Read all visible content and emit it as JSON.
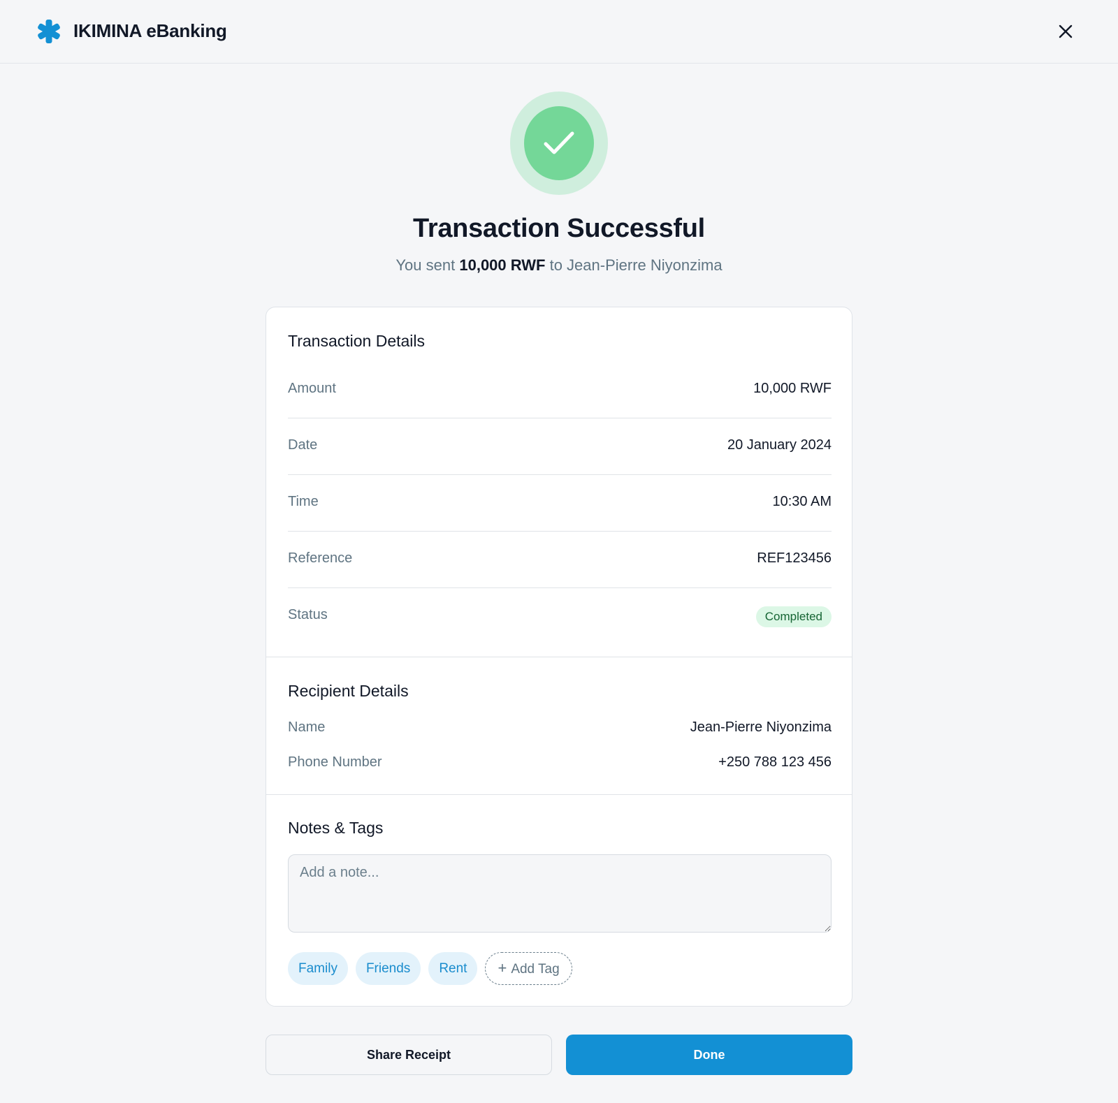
{
  "app": {
    "title": "IKIMINA eBanking",
    "logo_icon": "asterisk-logo-icon",
    "close_icon": "close-icon"
  },
  "hero": {
    "icon": "check-icon",
    "title": "Transaction Successful",
    "subtitle_prefix": "You sent",
    "subtitle_amount": "10,000 RWF",
    "subtitle_suffix": "to Jean-Pierre Niyonzima"
  },
  "transaction": {
    "title": "Transaction Details",
    "rows": [
      {
        "label": "Amount",
        "value": "10,000 RWF"
      },
      {
        "label": "Date",
        "value": "20 January 2024"
      },
      {
        "label": "Time",
        "value": "10:30 AM"
      },
      {
        "label": "Reference",
        "value": "REF123456"
      },
      {
        "label": "Status",
        "value": "Completed"
      }
    ]
  },
  "recipient": {
    "title": "Recipient Details",
    "rows": [
      {
        "label": "Name",
        "value": "Jean-Pierre Niyonzima"
      },
      {
        "label": "Phone Number",
        "value": "+250 788 123 456"
      }
    ]
  },
  "notes": {
    "title": "Notes & Tags",
    "placeholder": "Add a note...",
    "value": "",
    "tags": [
      "Family",
      "Friends",
      "Rent"
    ],
    "add_tag_label": "Add Tag"
  },
  "actions": {
    "share_label": "Share Receipt",
    "done_label": "Done"
  },
  "colors": {
    "brand": "#1390d4",
    "success": "#74d798",
    "success_halo": "#cfeedd",
    "status_badge_bg": "#dcf7e6",
    "status_badge_text": "#166534"
  }
}
